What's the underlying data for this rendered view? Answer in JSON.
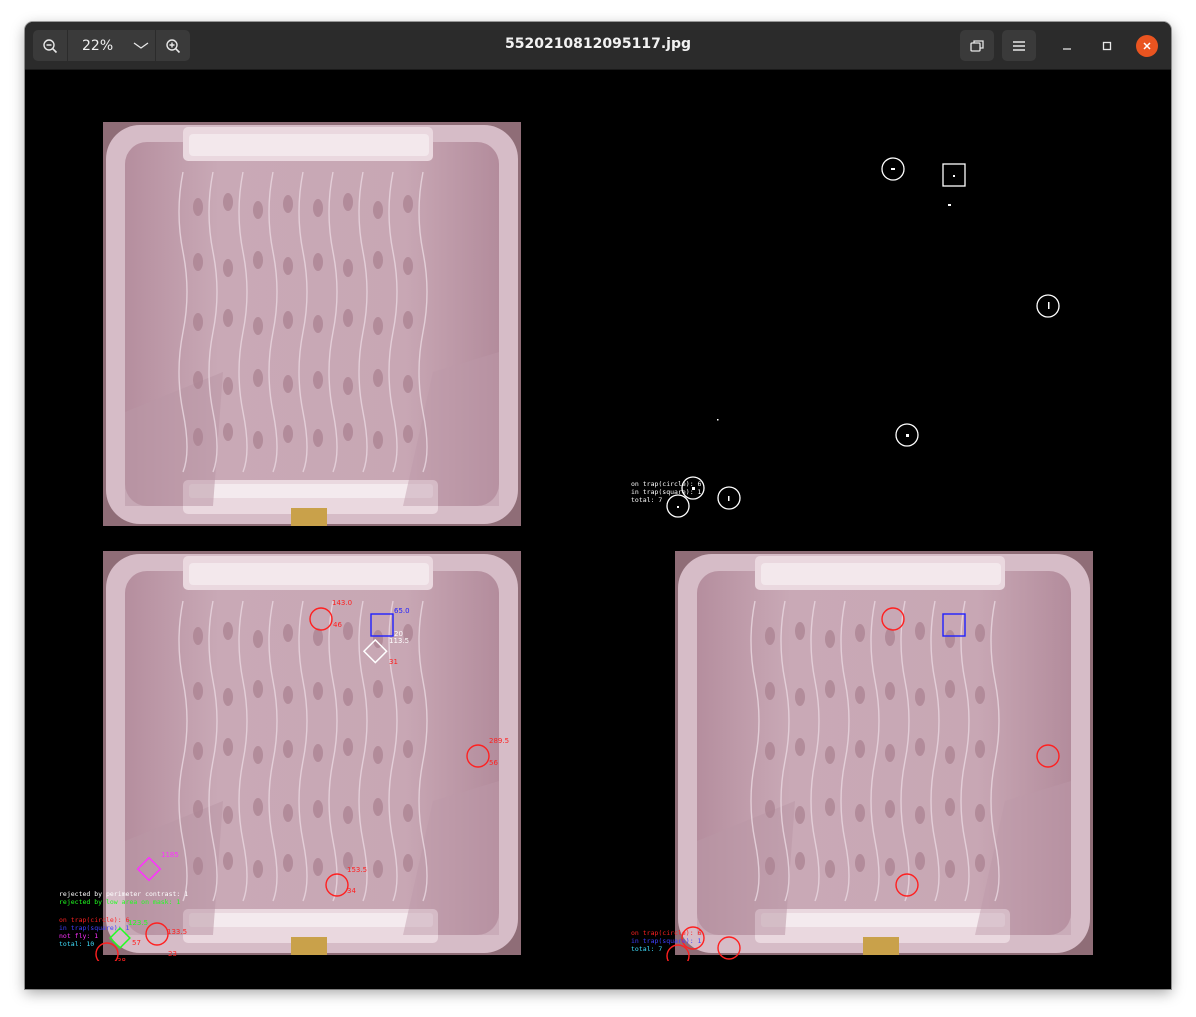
{
  "window": {
    "title": "5520210812095117.jpg"
  },
  "toolbar": {
    "zoom_value": "22%",
    "zoom_out_icon": "zoom-out-icon",
    "zoom_in_icon": "zoom-in-icon",
    "dropdown_icon": "chevron-down-icon",
    "fit_icon": "restore-view-icon",
    "menu_icon": "hamburger-menu-icon"
  },
  "colors": {
    "titlebar": "#2b2b2b",
    "close": "#e95420",
    "tray": "#c9a8b5",
    "red": "#ff2020",
    "blue": "#2020ff",
    "green": "#20ff20",
    "magenta": "#ff30ff",
    "cyan": "#40e0ff",
    "white": "#ffffff"
  },
  "annotations_panel_c": {
    "labels": [
      {
        "text": "143.0"
      },
      {
        "text": "46"
      },
      {
        "text": "65.0"
      },
      {
        "text": "20"
      },
      {
        "text": "113.5"
      },
      {
        "text": "31"
      },
      {
        "text": "289.5"
      },
      {
        "text": "56"
      },
      {
        "text": "153.5"
      },
      {
        "text": "34"
      },
      {
        "text": "123.5"
      },
      {
        "text": "57"
      },
      {
        "text": "133.5"
      },
      {
        "text": "23"
      },
      {
        "text": "38"
      },
      {
        "text": "1185"
      },
      {
        "text": "235.5"
      }
    ]
  },
  "legend_c": {
    "line1": "rejected by perimeter contrast: 1",
    "line2": "rejected by low area on mask: 1",
    "line3": "on trap(circle): 6",
    "line4": "in trap(square): 1",
    "line5": "not fly: 1",
    "line6": "total: 10"
  },
  "legend_d": {
    "line1": "on trap(circle): 6",
    "line2": "in trap(square): 1",
    "line3": "total: 7"
  },
  "legend_b": {
    "line1": "on trap(circle): 6",
    "line2": "in trap(square): 1",
    "line3": "total: 7"
  }
}
